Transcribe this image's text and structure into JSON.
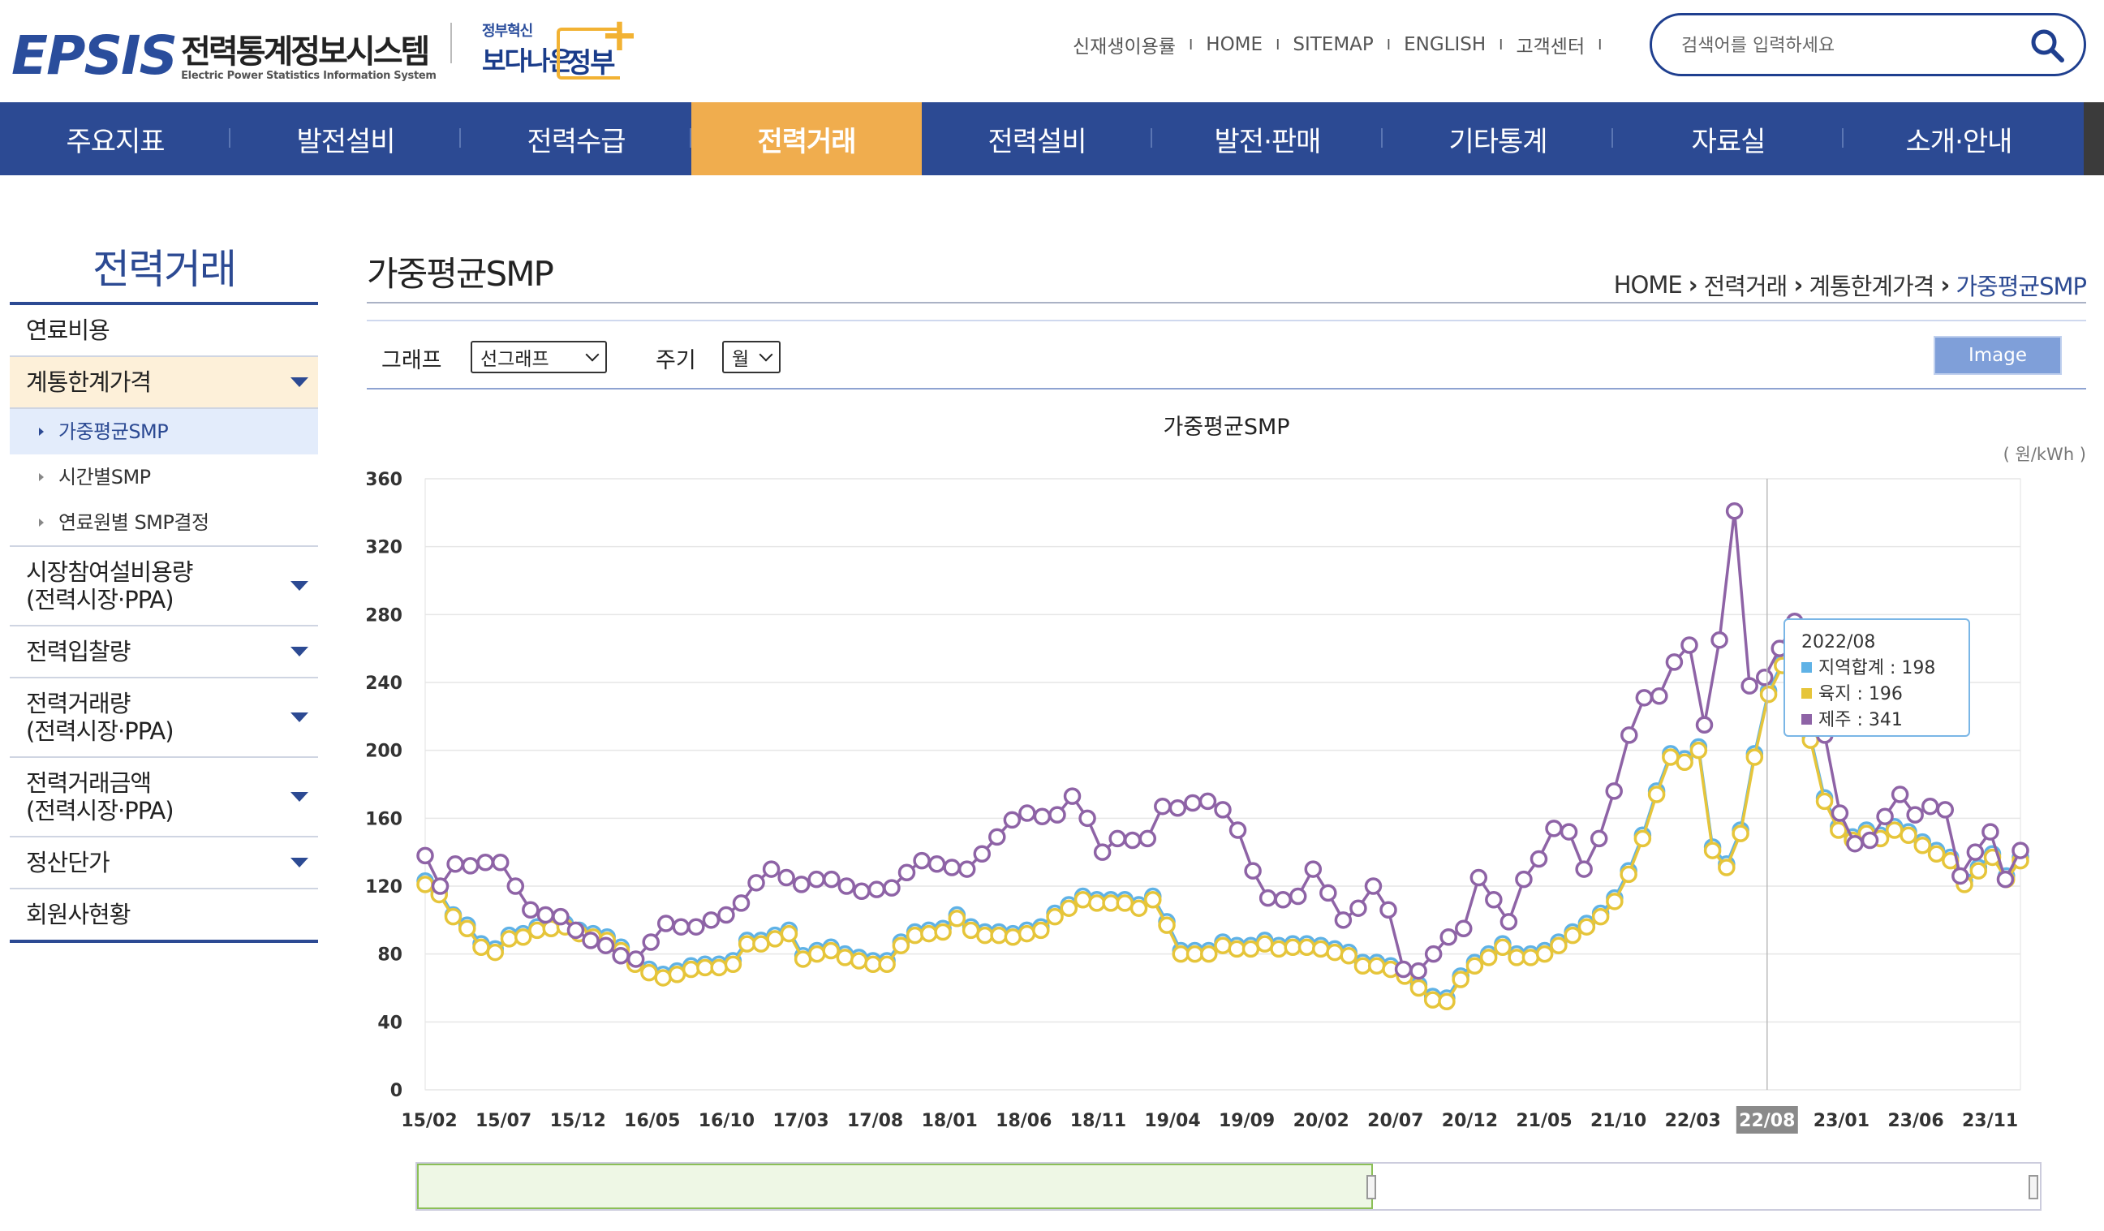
{
  "header": {
    "logo_main": "EPSIS",
    "logo_ko": "전력통계정보시스템",
    "logo_en": "Electric Power Statistics Information System",
    "gov_small": "정부혁신",
    "gov_big": "보다나은",
    "gov_word": "정부",
    "util_links": [
      "신재생이용률",
      "HOME",
      "SITEMAP",
      "ENGLISH",
      "고객센터"
    ],
    "search_placeholder": "검색어를 입력하세요"
  },
  "nav": {
    "items": [
      "주요지표",
      "발전설비",
      "전력수급",
      "전력거래",
      "전력설비",
      "발전·판매",
      "기타통계",
      "자료실",
      "소개·안내"
    ],
    "active_index": 3
  },
  "sidebar": {
    "title": "전력거래",
    "items": [
      {
        "label": "연료비용"
      },
      {
        "label": "계통한계가격"
      },
      {
        "label": "가중평균SMP"
      },
      {
        "label": "시간별SMP"
      },
      {
        "label": "연료원별 SMP결정"
      },
      {
        "label": "시장참여설비용량\n(전력시장·PPA)"
      },
      {
        "label": "전력입찰량"
      },
      {
        "label": "전력거래량\n(전력시장·PPA)"
      },
      {
        "label": "전력거래금액\n(전력시장·PPA)"
      },
      {
        "label": "정산단가"
      },
      {
        "label": "회원사현황"
      }
    ]
  },
  "main": {
    "page_title": "가중평균SMP",
    "breadcrumb": [
      "HOME",
      "전력거래",
      "계통한계가격",
      "가중평균SMP"
    ],
    "toolbar": {
      "graph_label": "그래프",
      "graph_value": "선그래프",
      "period_label": "주기",
      "period_value": "월",
      "image_button": "Image"
    },
    "chart_title": "가중평균SMP",
    "unit": "( 원/kWh )",
    "tooltip": {
      "date": "2022/08",
      "rows": [
        {
          "label": "지역합계",
          "value": "198"
        },
        {
          "label": "육지",
          "value": "196"
        },
        {
          "label": "제주",
          "value": "341"
        }
      ]
    }
  },
  "colors": {
    "nav_bg": "#2c4a93",
    "nav_active": "#f0ad4e",
    "series_total": "#5fb2e6",
    "series_land": "#e6c53a",
    "series_jeju": "#8e63a6"
  },
  "chart_data": {
    "type": "line",
    "title": "가중평균SMP",
    "unit": "원/kWh",
    "x_tick_labels": [
      "15/02",
      "15/07",
      "15/12",
      "16/05",
      "16/10",
      "17/03",
      "17/08",
      "18/01",
      "18/06",
      "18/11",
      "19/04",
      "19/09",
      "20/02",
      "20/07",
      "20/12",
      "21/05",
      "21/10",
      "22/03",
      "22/08",
      "23/01",
      "23/06",
      "23/11"
    ],
    "ylim": [
      0,
      360
    ],
    "y_ticks": [
      0,
      40,
      80,
      120,
      160,
      200,
      240,
      280,
      320,
      360
    ],
    "grid": "horizontal",
    "highlighted_x": "22/08",
    "series": [
      {
        "name": "지역합계",
        "values": [
          123,
          117,
          103,
          97,
          86,
          83,
          91,
          92,
          96,
          97,
          98,
          94,
          92,
          90,
          84,
          76,
          71,
          68,
          70,
          73,
          74,
          74,
          76,
          88,
          88,
          91,
          94,
          79,
          82,
          84,
          80,
          78,
          76,
          76,
          87,
          93,
          94,
          95,
          103,
          96,
          93,
          93,
          92,
          94,
          96,
          104,
          109,
          114,
          112,
          112,
          112,
          109,
          114,
          99,
          82,
          82,
          82,
          87,
          85,
          85,
          88,
          85,
          86,
          86,
          85,
          83,
          81,
          75,
          75,
          73,
          69,
          62,
          55,
          54,
          67,
          75,
          80,
          86,
          80,
          80,
          82,
          87,
          93,
          98,
          104,
          113,
          129,
          150,
          176,
          198,
          195,
          202,
          143,
          133,
          153,
          198,
          235,
          252,
          253,
          208,
          172,
          155,
          149,
          153,
          150,
          155,
          152,
          146,
          141,
          137,
          123,
          131,
          139,
          126,
          137
        ],
        "points_subset_note": ""
      },
      {
        "name": "육지",
        "values": [
          121,
          115,
          102,
          95,
          84,
          81,
          89,
          90,
          94,
          95,
          96,
          92,
          90,
          88,
          82,
          74,
          69,
          66,
          68,
          71,
          72,
          72,
          74,
          86,
          86,
          89,
          92,
          77,
          80,
          82,
          78,
          76,
          74,
          74,
          85,
          91,
          92,
          93,
          101,
          94,
          91,
          91,
          90,
          92,
          94,
          102,
          107,
          112,
          110,
          110,
          110,
          107,
          112,
          97,
          80,
          80,
          80,
          85,
          83,
          83,
          86,
          83,
          84,
          84,
          83,
          81,
          79,
          73,
          73,
          71,
          67,
          60,
          53,
          52,
          65,
          73,
          78,
          84,
          78,
          78,
          80,
          85,
          91,
          96,
          102,
          111,
          127,
          148,
          174,
          196,
          193,
          200,
          141,
          131,
          151,
          196,
          233,
          250,
          251,
          206,
          170,
          153,
          147,
          151,
          148,
          153,
          150,
          144,
          139,
          135,
          121,
          129,
          137,
          124,
          135
        ]
      },
      {
        "name": "제주",
        "values": [
          138,
          120,
          133,
          132,
          134,
          134,
          120,
          106,
          103,
          102,
          94,
          88,
          85,
          79,
          77,
          87,
          98,
          96,
          96,
          100,
          103,
          110,
          122,
          130,
          125,
          121,
          124,
          124,
          120,
          117,
          118,
          119,
          128,
          135,
          133,
          131,
          130,
          139,
          149,
          159,
          163,
          161,
          162,
          173,
          160,
          140,
          148,
          147,
          148,
          167,
          166,
          169,
          170,
          165,
          153,
          129,
          113,
          112,
          114,
          130,
          116,
          100,
          107,
          120,
          106,
          71,
          70,
          80,
          90,
          95,
          125,
          112,
          99,
          124,
          136,
          154,
          152,
          130,
          148,
          176,
          209,
          231,
          232,
          252,
          262,
          215,
          265,
          341,
          238,
          243,
          260,
          276,
          262,
          209,
          163,
          145,
          147,
          161,
          174,
          162,
          167,
          165,
          126,
          140,
          152,
          124,
          141
        ]
      }
    ]
  }
}
